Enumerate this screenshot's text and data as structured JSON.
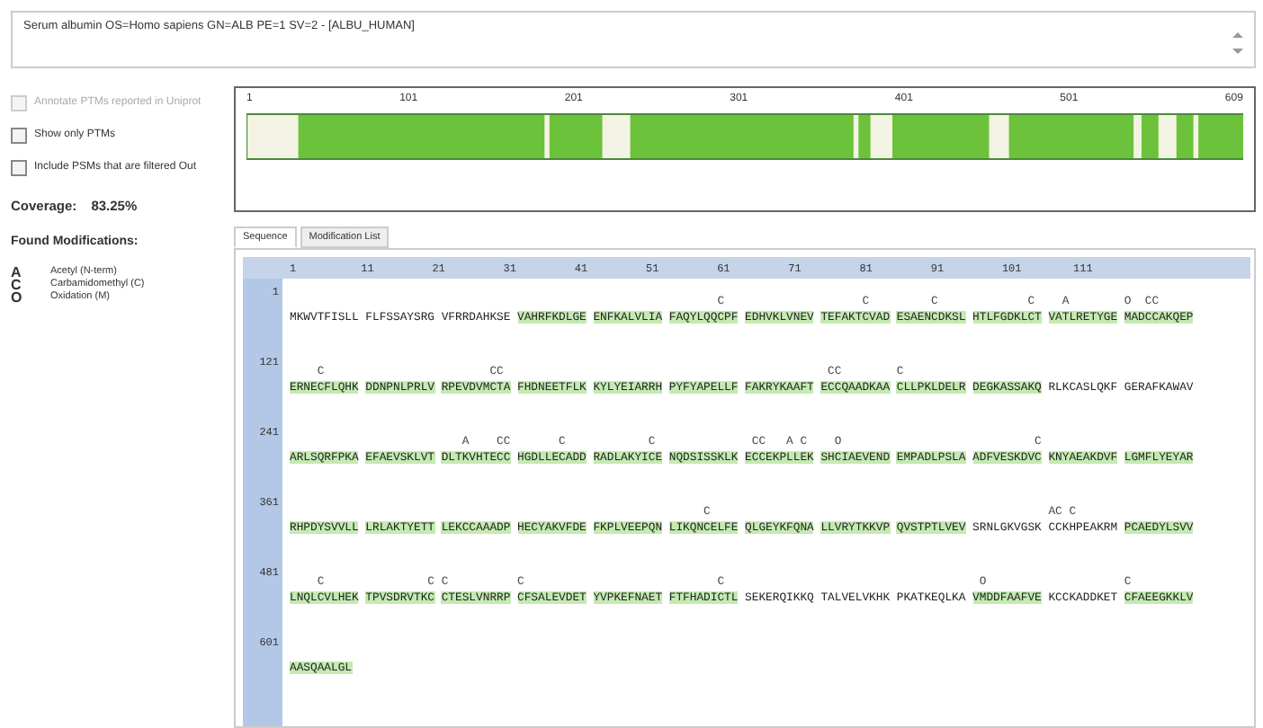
{
  "protein_title": "Serum albumin OS=Homo sapiens GN=ALB PE=1 SV=2 - [ALBU_HUMAN]",
  "options": [
    {
      "label": "Annotate PTMs reported in Uniprot",
      "checked": false,
      "disabled": true
    },
    {
      "label": "Show only PTMs",
      "checked": false,
      "disabled": false
    },
    {
      "label": "Include PSMs that are filtered Out",
      "checked": false,
      "disabled": false
    }
  ],
  "coverage": {
    "label": "Coverage:",
    "value": "83.25%"
  },
  "found_modifications": {
    "title": "Found Modifications:",
    "items": [
      {
        "symbol": "A",
        "name": "Acetyl (N-term)"
      },
      {
        "symbol": "C",
        "name": "Carbamidomethyl (C)"
      },
      {
        "symbol": "O",
        "name": "Oxidation (M)"
      }
    ]
  },
  "coverage_map": {
    "ticks": [
      "1",
      "101",
      "201",
      "301",
      "401",
      "501",
      "609"
    ]
  },
  "tabs": [
    {
      "label": "Sequence",
      "selected": true
    },
    {
      "label": "Modification List",
      "selected": false
    }
  ],
  "sequence": {
    "ruler": [
      "1",
      "11",
      "21",
      "31",
      "41",
      "51",
      "61",
      "71",
      "81",
      "91",
      "101",
      "111"
    ],
    "rows": [
      {
        "number": "1",
        "blocks": [
          {
            "residues": "MKWVTFISLL",
            "covered": false
          },
          {
            "residues": "FLFSSAYSRG",
            "covered": false
          },
          {
            "residues": "VFRRDAHKSE",
            "covered": false
          },
          {
            "residues": "VAHRFKDLGE",
            "covered": true
          },
          {
            "residues": "ENFKALVLIA",
            "covered": true
          },
          {
            "residues": "FAQYLQQCPF",
            "mods": "       C  ",
            "covered": true
          },
          {
            "residues": "EDHVKLVNEV",
            "covered": true
          },
          {
            "residues": "TEFAKTCVAD",
            "mods": "      C   ",
            "covered": true
          },
          {
            "residues": "ESAENCDKSL",
            "mods": "     C    ",
            "covered": true
          },
          {
            "residues": "HTLFGDKLCT",
            "mods": "        C ",
            "covered": true
          },
          {
            "residues": "VATLRETYGE",
            "mods": "  A       ",
            "covered": true
          },
          {
            "residues": "MADCCAKQEP",
            "mods": "O  CC",
            "covered": true
          }
        ]
      },
      {
        "number": "121",
        "blocks": [
          {
            "residues": "ERNECFLQHK",
            "mods": "    C",
            "covered": true
          },
          {
            "residues": "DDNPNLPRLV",
            "covered": true
          },
          {
            "residues": "RPEVDVMCTA",
            "mods": "       CC",
            "covered": true
          },
          {
            "residues": "FHDNEETFLK",
            "covered": true
          },
          {
            "residues": "KYLYEIARRH",
            "covered": true
          },
          {
            "residues": "PYFYAPELLF",
            "covered": true
          },
          {
            "residues": "FAKRYKAAFT",
            "covered": true
          },
          {
            "residues": "ECCQAADKAA",
            "mods": " CC",
            "covered": true
          },
          {
            "residues": "CLLPKLDELR",
            "mods": "C",
            "covered": true
          },
          {
            "residues": "DEGKASSAKQ",
            "covered": true
          },
          {
            "residues": "RLKCASLQKF",
            "covered": false
          },
          {
            "residues": "GERAFKAWAV",
            "covered": false
          }
        ]
      },
      {
        "number": "241",
        "blocks": [
          {
            "residues": "ARLSQRFPKA",
            "covered": true
          },
          {
            "residues": "EFAEVSKLVT",
            "covered": true
          },
          {
            "residues": "DLTKVHTECC",
            "mods": "   A    CC",
            "covered": true
          },
          {
            "residues": "HGDLLECADD",
            "mods": "      C",
            "covered": true
          },
          {
            "residues": "RADLAKYICE",
            "mods": "        C",
            "covered": true
          },
          {
            "residues": "NQDSISSKLK",
            "covered": true
          },
          {
            "residues": "ECCEKPLLEK",
            "mods": " CC   A C",
            "covered": true
          },
          {
            "residues": "SHCIAEVEND",
            "mods": "  O",
            "covered": true
          },
          {
            "residues": "EMPADLPSLA",
            "covered": true
          },
          {
            "residues": "ADFVESKDVC",
            "mods": "         C",
            "covered": true
          },
          {
            "residues": "KNYAEAKDVF",
            "covered": true
          },
          {
            "residues": "LGMFLYEYAR",
            "covered": true
          }
        ]
      },
      {
        "number": "361",
        "blocks": [
          {
            "residues": "RHPDYSVVLL",
            "covered": true
          },
          {
            "residues": "LRLAKTYETT",
            "covered": true
          },
          {
            "residues": "LEKCCAAADP",
            "covered": true
          },
          {
            "residues": "HECYAKVFDE",
            "covered": true
          },
          {
            "residues": "FKPLVEEPQN",
            "covered": true
          },
          {
            "residues": "LIKQNCELFE",
            "mods": "     C",
            "covered": true
          },
          {
            "residues": "QLGEYKFQNA",
            "covered": true
          },
          {
            "residues": "LLVRYTKKVP",
            "covered": true
          },
          {
            "residues": "QVSTPTLVEV",
            "covered": true
          },
          {
            "residues": "SRNLGKVGSK",
            "covered": false
          },
          {
            "residues": "CCKHPEAKRM",
            "mods": "AC C",
            "covered": false
          },
          {
            "residues": "PCAEDYLSVV",
            "covered": true
          }
        ]
      },
      {
        "number": "481",
        "blocks": [
          {
            "residues": "LNQLCVLHEK",
            "mods": "    C",
            "covered": true
          },
          {
            "residues": "TPVSDRVTKC",
            "mods": "         C",
            "covered": true
          },
          {
            "residues": "CTESLVNRRP",
            "mods": "C",
            "covered": true
          },
          {
            "residues": "CFSALEVDET",
            "mods": "C",
            "covered": true
          },
          {
            "residues": "YVPKEFNAET",
            "covered": true
          },
          {
            "residues": "FTFHADICTL",
            "mods": "       C",
            "covered": true
          },
          {
            "residues": "SEKERQIKKQ",
            "covered": false
          },
          {
            "residues": "TALVELVKHK",
            "covered": false
          },
          {
            "residues": "PKATKEQLKA",
            "covered": false
          },
          {
            "residues": "VMDDFAAFVE",
            "mods": " O",
            "covered": true
          },
          {
            "residues": "KCCKADDKET",
            "covered": false
          },
          {
            "residues": "CFAEEGKKLV",
            "mods": "C",
            "covered": true
          }
        ]
      },
      {
        "number": "601",
        "blocks": [
          {
            "residues": "AASQAALGL",
            "covered": true
          }
        ]
      }
    ]
  }
}
